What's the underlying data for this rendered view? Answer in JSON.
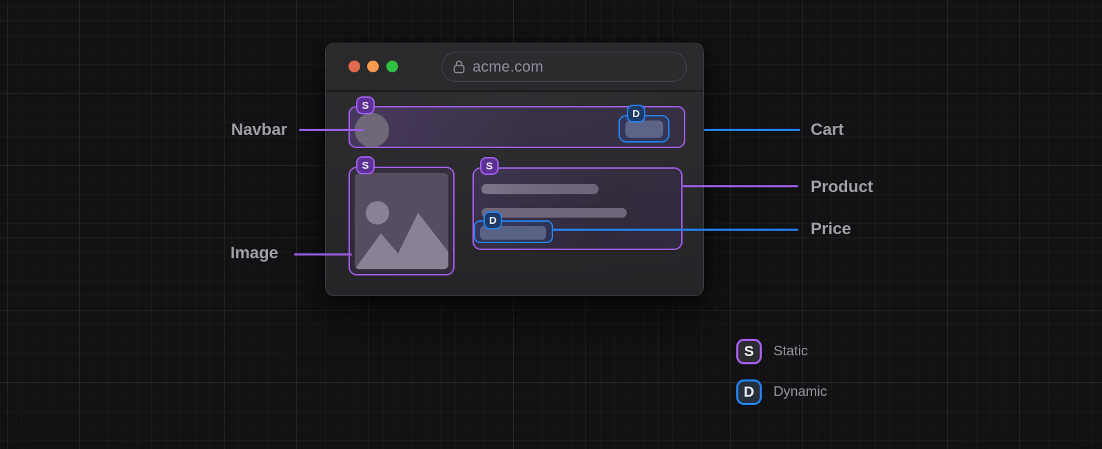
{
  "browser": {
    "url": "acme.com",
    "window_controls": [
      "close",
      "minimize",
      "zoom"
    ]
  },
  "annotations": {
    "navbar": {
      "label": "Navbar",
      "badge": "S",
      "type": "static"
    },
    "cart": {
      "label": "Cart",
      "badge": "D",
      "type": "dynamic"
    },
    "image": {
      "label": "Image",
      "badge": "S",
      "type": "static"
    },
    "product": {
      "label": "Product",
      "badge": "S",
      "type": "static"
    },
    "price": {
      "label": "Price",
      "badge": "D",
      "type": "dynamic"
    }
  },
  "legend": {
    "static": {
      "badge": "S",
      "label": "Static"
    },
    "dynamic": {
      "badge": "D",
      "label": "Dynamic"
    }
  },
  "colors": {
    "static_accent": "#a560f0",
    "dynamic_accent": "#2383f2",
    "traffic_close": "#e26a4e",
    "traffic_minimize": "#f49a51",
    "traffic_zoom": "#30c043",
    "background": "#121214",
    "window": "#2a292c",
    "label_text": "#9fa0a6"
  }
}
